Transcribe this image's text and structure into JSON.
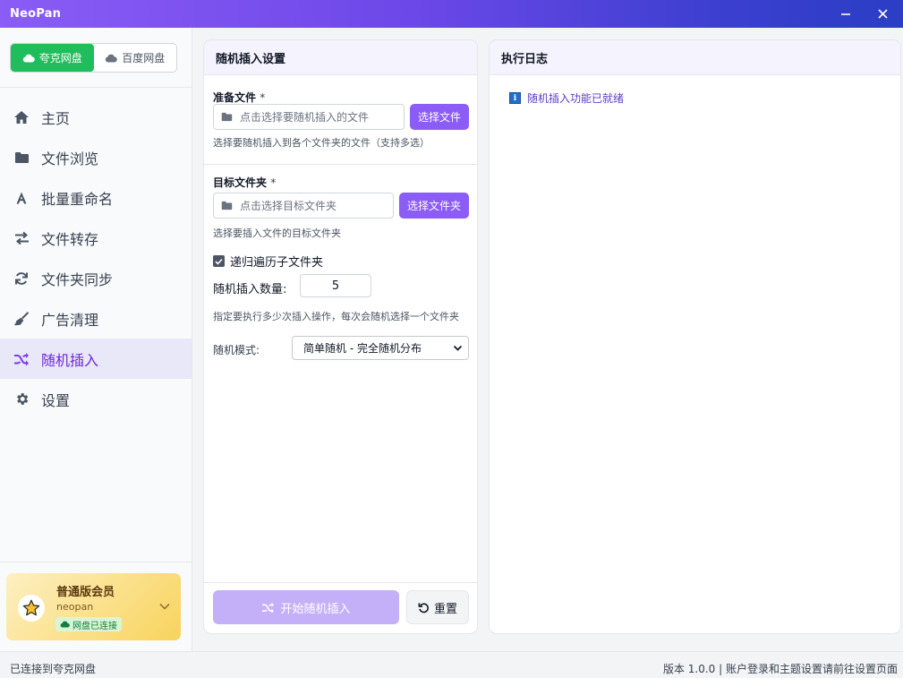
{
  "app": {
    "title": "NeoPan"
  },
  "window": {
    "minimize": "—",
    "close": "✕"
  },
  "drive_switch": {
    "options": [
      {
        "label": "夸克网盘",
        "active": true
      },
      {
        "label": "百度网盘",
        "active": false
      }
    ]
  },
  "sidebar": {
    "items": [
      {
        "label": "主页",
        "icon": "home-icon"
      },
      {
        "label": "文件浏览",
        "icon": "folder-icon"
      },
      {
        "label": "批量重命名",
        "icon": "letter-a-icon"
      },
      {
        "label": "文件转存",
        "icon": "transfer-icon"
      },
      {
        "label": "文件夹同步",
        "icon": "sync-icon"
      },
      {
        "label": "广告清理",
        "icon": "broom-icon"
      },
      {
        "label": "随机插入",
        "icon": "shuffle-icon",
        "active": true
      },
      {
        "label": "设置",
        "icon": "gear-icon"
      }
    ]
  },
  "member": {
    "tier": "普通版会员",
    "username": "neopan",
    "status": "网盘已连接"
  },
  "settings_panel": {
    "title": "随机插入设置",
    "prepare_file": {
      "label": "准备文件",
      "required": "*",
      "placeholder": "点击选择要随机插入的文件",
      "button": "选择文件",
      "hint": "选择要随机插入到各个文件夹的文件（支持多选）"
    },
    "target_folder": {
      "label": "目标文件夹",
      "required": "*",
      "placeholder": "点击选择目标文件夹",
      "button": "选择文件夹",
      "hint": "选择要插入文件的目标文件夹"
    },
    "recursive": {
      "label": "递归遍历子文件夹",
      "checked": true
    },
    "count": {
      "label": "随机插入数量:",
      "value": "5"
    },
    "count_hint": "指定要执行多少次插入操作，每次会随机选择一个文件夹",
    "mode": {
      "label": "随机模式:",
      "value": "简单随机 - 完全随机分布"
    },
    "start_button": "开始随机插入",
    "reset_button": "重置"
  },
  "log_panel": {
    "title": "执行日志",
    "entries": [
      {
        "type": "info",
        "text": "随机插入功能已就绪"
      }
    ]
  },
  "statusbar": {
    "left": "已连接到夸克网盘",
    "right": "版本 1.0.0 | 账户登录和主题设置请前往设置页面"
  },
  "colors": {
    "accent": "#8b5cf6",
    "drive_active": "#1fbd5c",
    "nav_active_bg": "#e8e8f8",
    "log_text": "#5b3cc4"
  }
}
